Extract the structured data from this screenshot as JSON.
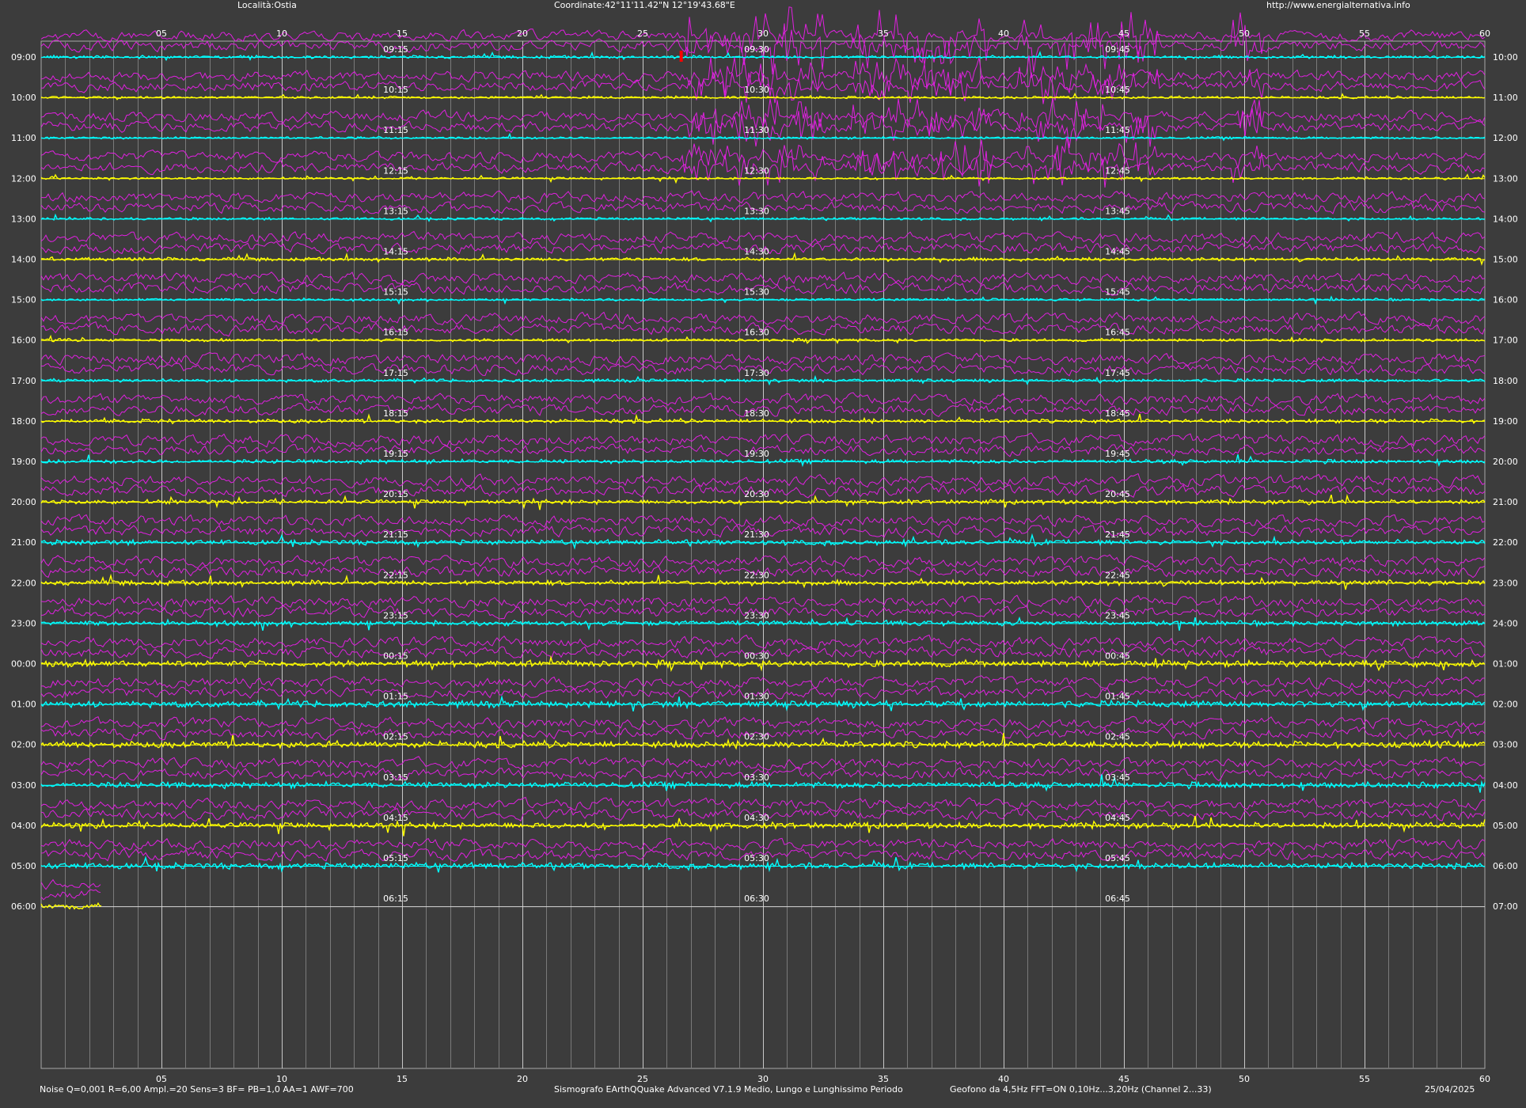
{
  "header": {
    "location": "Località:Ostia",
    "coordinates": "Coordinate:42°11'11.42\"N  12°19'43.68\"E",
    "url": "http://www.energialternativa.info"
  },
  "footer": {
    "parameters": "Noise Q=0,001 R=6,00 Ampl.=20 Sens=3 BF= PB=1,0 AA=1 AWF=700",
    "software": "Sismografo  EArthQQuake Advanced V7.1.9  Medio, Lungo e Lunghissimo Periodo",
    "sensor": "Geofono da 4,5Hz FFT=ON 0,10Hz...3,20Hz      (Channel 2...33)",
    "date": "25/04/2025"
  },
  "colors": {
    "background": "#3c3c3c",
    "grid": "#a8a8a8",
    "trace_cyan": "#00ffff",
    "trace_yellow": "#ffff00",
    "trace_magenta": "#e020e0",
    "event_marker": "#ff0000",
    "text": "#ffffff"
  },
  "chart_data": {
    "type": "line",
    "title": "",
    "xlabel": "",
    "ylabel": "",
    "x_ticks": [
      "05",
      "10",
      "15",
      "20",
      "25",
      "30",
      "35",
      "40",
      "45",
      "50",
      "55",
      "60"
    ],
    "xlim": [
      0,
      60
    ],
    "grid": true,
    "left_hour_labels": [
      "09:00",
      "10:00",
      "11:00",
      "12:00",
      "13:00",
      "14:00",
      "15:00",
      "16:00",
      "17:00",
      "18:00",
      "19:00",
      "20:00",
      "21:00",
      "22:00",
      "23:00",
      "00:00",
      "01:00",
      "02:00",
      "03:00",
      "04:00",
      "05:00",
      "06:00"
    ],
    "right_hour_labels": [
      "10:00",
      "11:00",
      "12:00",
      "13:00",
      "14:00",
      "15:00",
      "16:00",
      "17:00",
      "18:00",
      "19:00",
      "20:00",
      "21:00",
      "22:00",
      "23:00",
      "24:00",
      "01:00",
      "02:00",
      "03:00",
      "04:00",
      "05:00",
      "06:00",
      "07:00"
    ],
    "quarter_marks": [
      [
        "09:15",
        "09:30",
        "09:45"
      ],
      [
        "10:15",
        "10:30",
        "10:45"
      ],
      [
        "11:15",
        "11:30",
        "11:45"
      ],
      [
        "12:15",
        "12:30",
        "12:45"
      ],
      [
        "13:15",
        "13:30",
        "13:45"
      ],
      [
        "14:15",
        "14:30",
        "14:45"
      ],
      [
        "15:15",
        "15:30",
        "15:45"
      ],
      [
        "16:15",
        "16:30",
        "16:45"
      ],
      [
        "17:15",
        "17:30",
        "17:45"
      ],
      [
        "18:15",
        "18:30",
        "18:45"
      ],
      [
        "19:15",
        "19:30",
        "19:45"
      ],
      [
        "20:15",
        "20:30",
        "20:45"
      ],
      [
        "21:15",
        "21:30",
        "21:45"
      ],
      [
        "22:15",
        "22:30",
        "22:45"
      ],
      [
        "23:15",
        "23:30",
        "23:45"
      ],
      [
        "00:15",
        "00:30",
        "00:45"
      ],
      [
        "01:15",
        "01:30",
        "01:45"
      ],
      [
        "02:15",
        "02:30",
        "02:45"
      ],
      [
        "03:15",
        "03:30",
        "03:45"
      ],
      [
        "04:15",
        "04:30",
        "04:45"
      ],
      [
        "05:15",
        "05:30",
        "05:45"
      ],
      [
        "06:15",
        "06:30",
        "06:45"
      ]
    ],
    "last_row_progress_minutes": 2.5,
    "trace_amplitude_levels": [
      1.2,
      1.0,
      0.9,
      0.9,
      1.0,
      1.4,
      1.0,
      1.2,
      1.3,
      1.6,
      1.6,
      1.8,
      2.0,
      2.0,
      2.0,
      2.6,
      2.6,
      2.6,
      2.4,
      2.4,
      2.4,
      2.2
    ],
    "event_windows_minutes": [
      [
        26.7,
        32.5
      ],
      [
        33.5,
        39.5
      ],
      [
        40.5,
        46.5
      ],
      [
        49.5,
        50.8
      ]
    ],
    "event_marker_minute": 26.6
  }
}
